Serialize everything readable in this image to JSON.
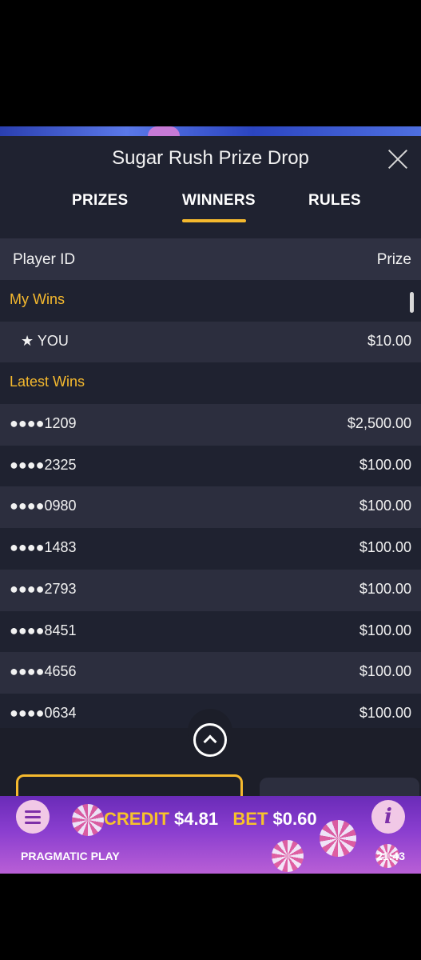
{
  "header": {
    "title": "Sugar Rush Prize Drop",
    "tabs": [
      {
        "label": "PRIZES",
        "active": false
      },
      {
        "label": "WINNERS",
        "active": true
      },
      {
        "label": "RULES",
        "active": false
      }
    ]
  },
  "table": {
    "col_player": "Player ID",
    "col_prize": "Prize"
  },
  "sections": {
    "my_wins": "My Wins",
    "latest_wins": "Latest Wins"
  },
  "my_wins": [
    {
      "player": "★ YOU",
      "prize": "$10.00"
    }
  ],
  "latest_wins": [
    {
      "player": "●●●●1209",
      "prize": "$2,500.00"
    },
    {
      "player": "●●●●2325",
      "prize": "$100.00"
    },
    {
      "player": "●●●●0980",
      "prize": "$100.00"
    },
    {
      "player": "●●●●1483",
      "prize": "$100.00"
    },
    {
      "player": "●●●●2793",
      "prize": "$100.00"
    },
    {
      "player": "●●●●8451",
      "prize": "$100.00"
    },
    {
      "player": "●●●●4656",
      "prize": "$100.00"
    },
    {
      "player": "●●●●0634",
      "prize": "$100.00"
    }
  ],
  "footer": {
    "credit_label": "CREDIT",
    "credit_value": "$4.81",
    "bet_label": "BET",
    "bet_value": "$0.60",
    "brand": "PRAGMATIC PLAY",
    "time": "21:43"
  },
  "colors": {
    "accent": "#f5b92e",
    "panel_bg": "#1f2230",
    "row_alt_bg": "#2c2e3e",
    "footer_purple": "#8a3ecf"
  },
  "icons": [
    "close-icon",
    "chevron-up-icon",
    "menu-icon",
    "info-icon"
  ]
}
